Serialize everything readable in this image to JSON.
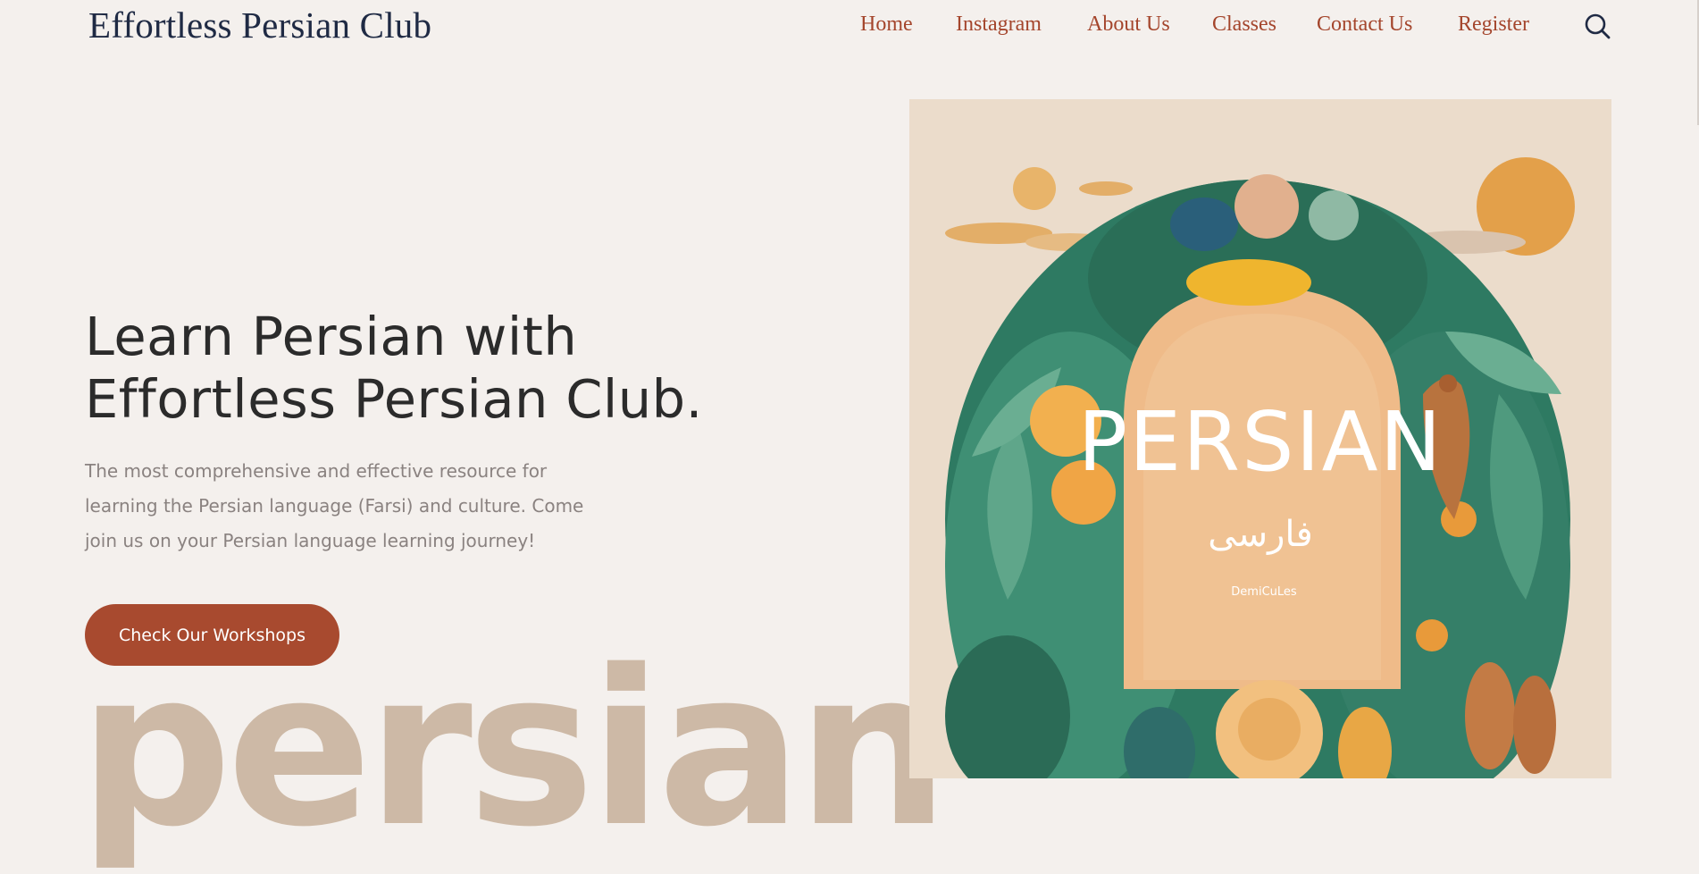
{
  "site": {
    "title": "Effortless Persian Club"
  },
  "nav": {
    "items": [
      {
        "label": "Home"
      },
      {
        "label": "Instagram"
      },
      {
        "label": "About Us"
      },
      {
        "label": "Classes"
      },
      {
        "label": "Contact Us"
      },
      {
        "label": "Register"
      }
    ],
    "search_icon": "search-icon"
  },
  "hero": {
    "heading_line1": "Learn Persian with",
    "heading_line2": "Effortless Persian Club.",
    "description": "The most comprehensive and effective resource for learning the Persian language (Farsi) and culture. Come join us on your Persian language learning journey!",
    "cta_label": "Check Our Workshops",
    "big_word": "persian"
  },
  "poster": {
    "title": "PERSIAN",
    "script_text": "فارسی",
    "small_text": "DemiCuLes"
  },
  "colors": {
    "background": "#f4f0ed",
    "accent": "#a84a2f",
    "nav_link": "#a4452c",
    "heading": "#2b2b2b",
    "title": "#1f2a44",
    "big_word": "#cdb9a6"
  }
}
